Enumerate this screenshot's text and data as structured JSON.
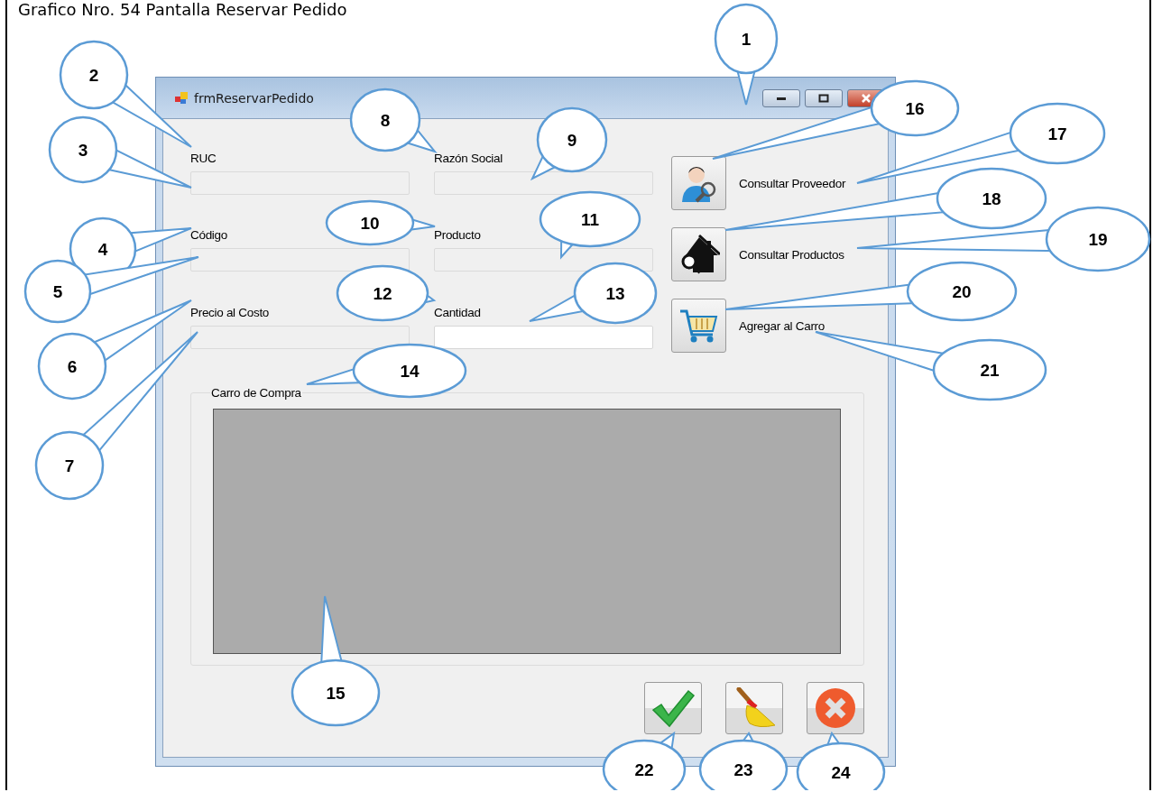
{
  "caption": "Grafico Nro. 54 Pantalla Reservar Pedido",
  "window": {
    "title": "frmReservarPedido"
  },
  "fields": [
    {
      "label": "RUC",
      "disabled": true
    },
    {
      "label": "Razón Social",
      "disabled": true
    },
    {
      "label": "Código",
      "disabled": true
    },
    {
      "label": "Producto",
      "disabled": true
    },
    {
      "label": "Precio al Costo",
      "disabled": true
    },
    {
      "label": "Cantidad",
      "disabled": false
    }
  ],
  "actions": [
    {
      "kind": "supplier",
      "label": "Consultar Proveedor"
    },
    {
      "kind": "products",
      "label": "Consultar Productos"
    },
    {
      "kind": "cart",
      "label": "Agregar al Carro"
    }
  ],
  "cart_group": {
    "title": "Carro de Compra"
  },
  "footer_buttons": [
    {
      "kind": "accept"
    },
    {
      "kind": "clear"
    },
    {
      "kind": "cancel"
    }
  ],
  "callouts": [
    "1",
    "2",
    "3",
    "4",
    "5",
    "6",
    "7",
    "8",
    "9",
    "10",
    "11",
    "12",
    "13",
    "14",
    "15",
    "16",
    "17",
    "18",
    "19",
    "20",
    "21",
    "22",
    "23",
    "24"
  ]
}
